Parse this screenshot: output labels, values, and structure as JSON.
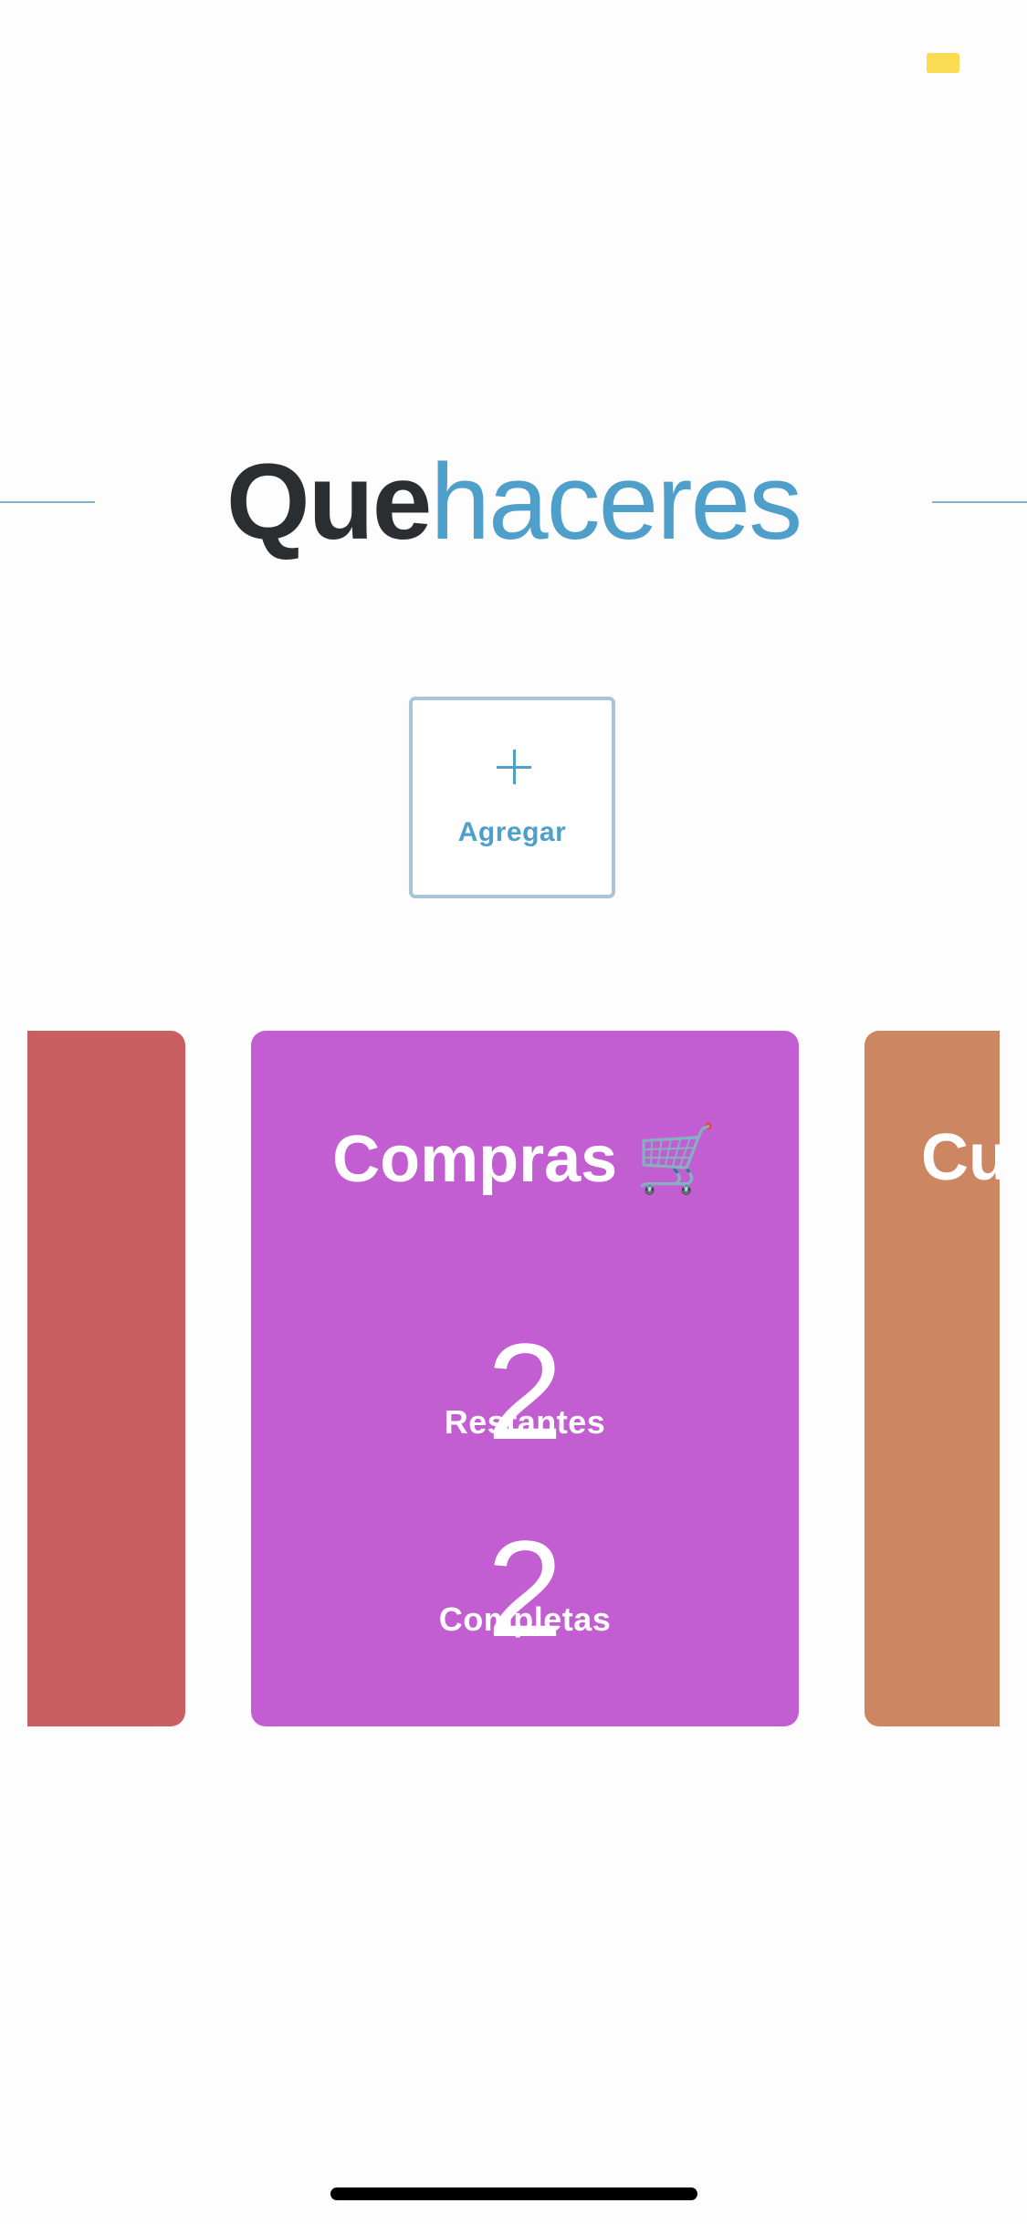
{
  "colors": {
    "accent": "#4f9fcb",
    "dark": "#2b2e30",
    "battery": "#f9dc52",
    "rule": "#7fb3c9",
    "card_prev": "#c95f63",
    "card_current": "#c25ed1",
    "card_next": "#cc8762"
  },
  "status_bar": {
    "battery_icon": "battery-icon"
  },
  "title": {
    "bold_part": "Que",
    "light_part": "haceres"
  },
  "add_button": {
    "icon": "plus-icon",
    "label": "Agregar"
  },
  "cards": {
    "prev": {
      "emoji": "🏠"
    },
    "current": {
      "title": "Compras 🛒",
      "remaining_value": "2",
      "remaining_label": "Restantes",
      "completed_value": "2",
      "completed_label": "Completas"
    },
    "next": {
      "title": "Cu"
    }
  }
}
